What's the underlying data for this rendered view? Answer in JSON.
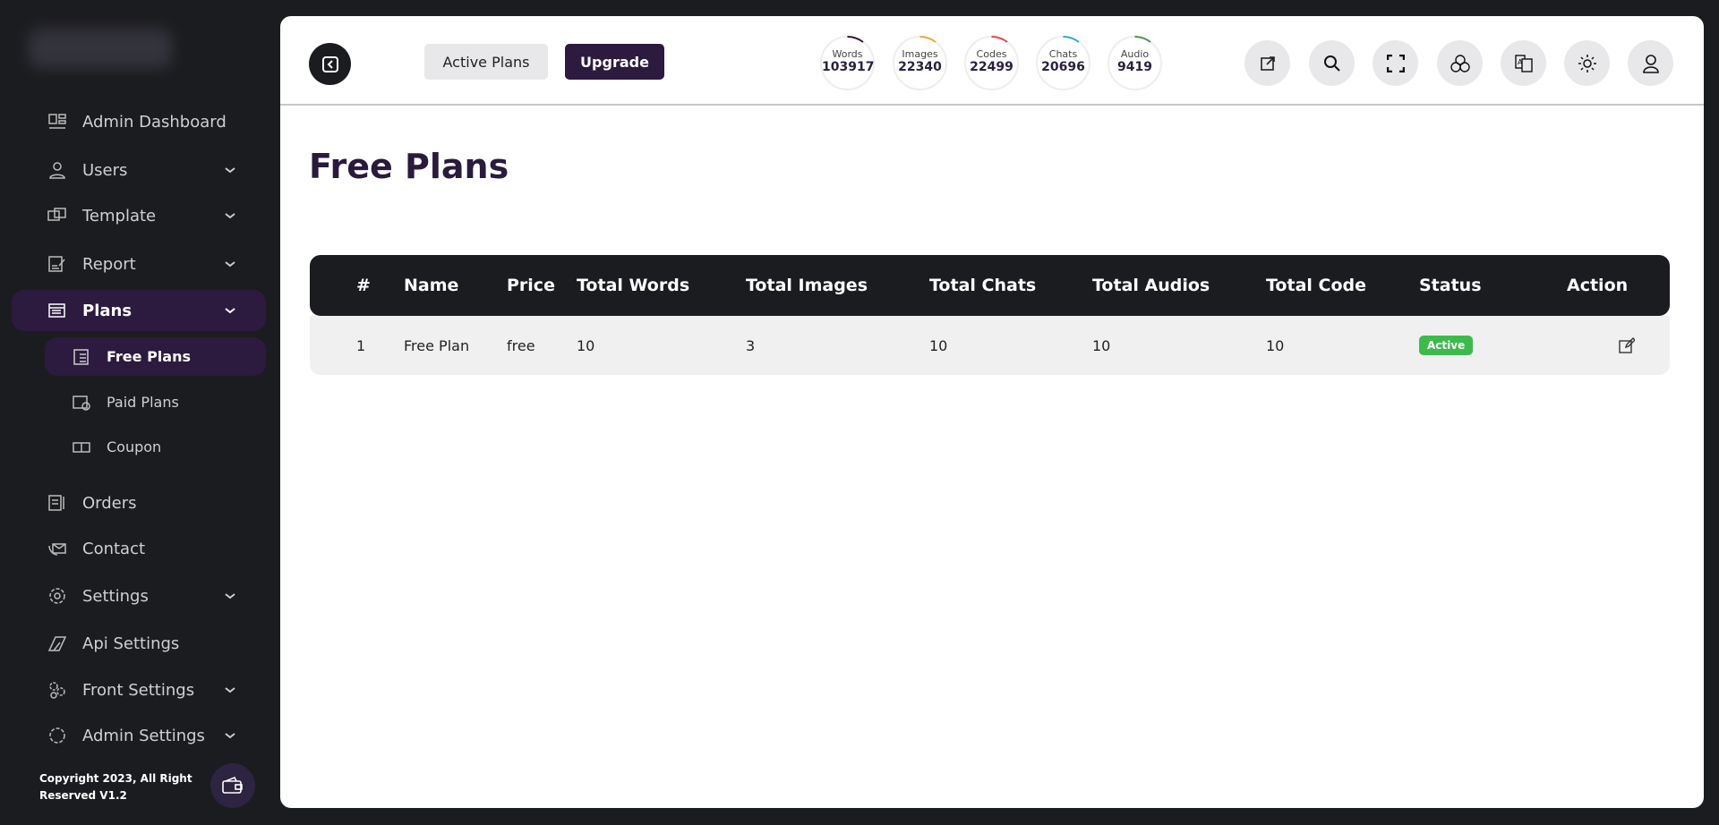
{
  "sidebar": {
    "items": [
      {
        "label": "Admin Dashboard"
      },
      {
        "label": "Users"
      },
      {
        "label": "Template"
      },
      {
        "label": "Report"
      },
      {
        "label": "Plans"
      },
      {
        "label": "Free Plans"
      },
      {
        "label": "Paid Plans"
      },
      {
        "label": "Coupon"
      },
      {
        "label": "Orders"
      },
      {
        "label": "Contact"
      },
      {
        "label": "Settings"
      },
      {
        "label": "Api Settings"
      },
      {
        "label": "Front Settings"
      },
      {
        "label": "Admin Settings"
      }
    ],
    "footer": {
      "line1": "Copyright 2023, All Right",
      "line2": "Reserved V1.2"
    }
  },
  "header": {
    "active_plans": "Active Plans",
    "upgrade": "Upgrade",
    "stats": [
      {
        "label": "Words",
        "value": "103917",
        "color": "#2c1a3f"
      },
      {
        "label": "Images",
        "value": "22340",
        "color": "#f0a830"
      },
      {
        "label": "Codes",
        "value": "22499",
        "color": "#ef4050"
      },
      {
        "label": "Chats",
        "value": "20696",
        "color": "#2ea8e0"
      },
      {
        "label": "Audio",
        "value": "9419",
        "color": "#4a9a4a"
      }
    ]
  },
  "page": {
    "title": "Free Plans"
  },
  "table": {
    "headers": [
      "#",
      "Name",
      "Price",
      "Total Words",
      "Total Images",
      "Total Chats",
      "Total Audios",
      "Total Code",
      "Status",
      "Action"
    ],
    "rows": [
      {
        "num": "1",
        "name": "Free Plan",
        "price": "free",
        "words": "10",
        "images": "3",
        "chats": "10",
        "audios": "10",
        "code": "10",
        "status": "Active"
      }
    ]
  }
}
